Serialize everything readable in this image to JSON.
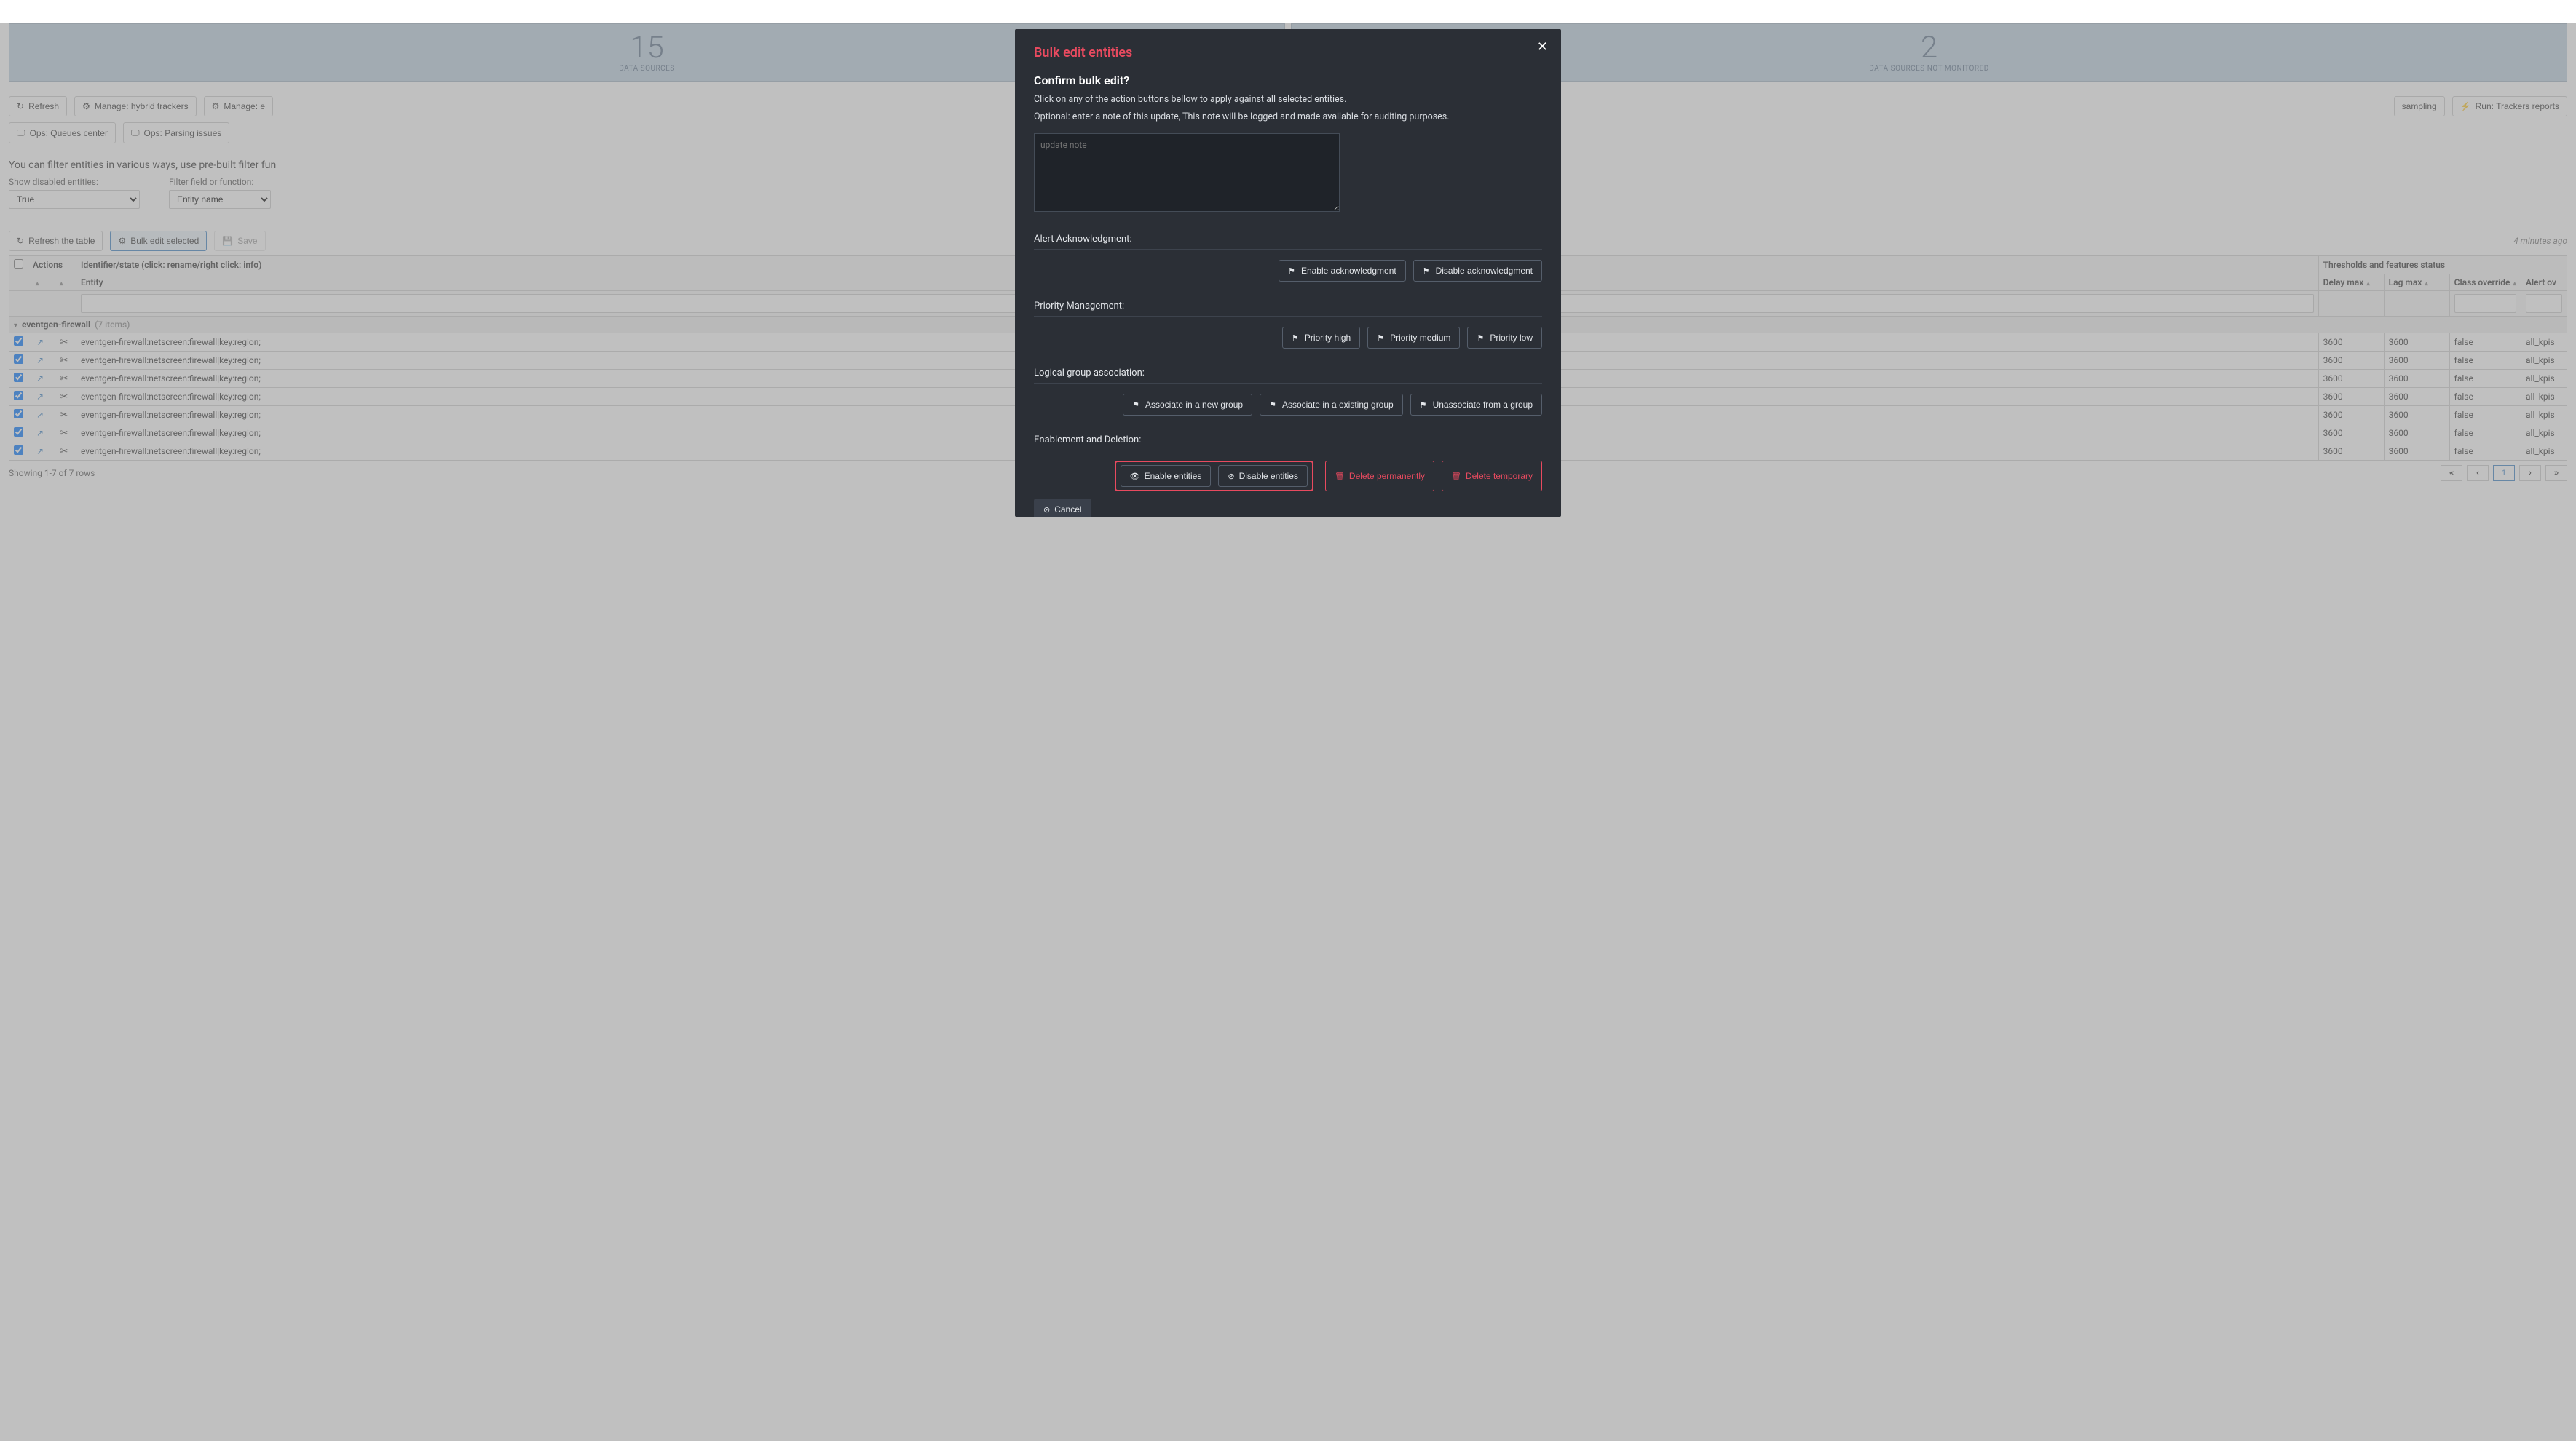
{
  "stats": [
    {
      "value": "15",
      "label": "DATA SOURCES"
    },
    {
      "value": "2",
      "label": "DATA SOURCES NOT MONITORED"
    }
  ],
  "toolbar": {
    "refresh": "Refresh",
    "manage_hybrid": "Manage: hybrid trackers",
    "manage_elastic": "Manage: e",
    "run_sampling": "sampling",
    "run_trackers": "Run: Trackers reports",
    "ops_queues": "Ops: Queues center",
    "ops_parsing": "Ops: Parsing issues"
  },
  "filter_hint": "You can filter entities in various ways, use pre-built filter fun",
  "filter": {
    "show_disabled_label": "Show disabled entities:",
    "show_disabled_value": "True",
    "field_label": "Filter field or function:",
    "field_value": "Entity name"
  },
  "actions": {
    "refresh_table": "Refresh the table",
    "bulk_edit": "Bulk edit selected",
    "save": "Save",
    "timestamp": "4 minutes ago"
  },
  "table": {
    "headers": {
      "actions": "Actions",
      "identifier": "Identifier/state (click: rename/right click: info)",
      "thresholds": "Thresholds and features status"
    },
    "sub_headers": {
      "entity": "Entity",
      "delay_max": "Delay max",
      "lag_max": "Lag max",
      "class_override": "Class override",
      "alert_override": "Alert ov"
    },
    "group": {
      "name": "eventgen-firewall",
      "count": "(7 items)"
    },
    "rows": [
      {
        "entity": "eventgen-firewall:netscreen:firewall|key:region;",
        "delay_max": "3600",
        "lag_max": "3600",
        "class_override": "false",
        "alert_override": "all_kpis"
      },
      {
        "entity": "eventgen-firewall:netscreen:firewall|key:region;",
        "delay_max": "3600",
        "lag_max": "3600",
        "class_override": "false",
        "alert_override": "all_kpis"
      },
      {
        "entity": "eventgen-firewall:netscreen:firewall|key:region;",
        "delay_max": "3600",
        "lag_max": "3600",
        "class_override": "false",
        "alert_override": "all_kpis"
      },
      {
        "entity": "eventgen-firewall:netscreen:firewall|key:region;",
        "delay_max": "3600",
        "lag_max": "3600",
        "class_override": "false",
        "alert_override": "all_kpis"
      },
      {
        "entity": "eventgen-firewall:netscreen:firewall|key:region;",
        "delay_max": "3600",
        "lag_max": "3600",
        "class_override": "false",
        "alert_override": "all_kpis"
      },
      {
        "entity": "eventgen-firewall:netscreen:firewall|key:region;",
        "delay_max": "3600",
        "lag_max": "3600",
        "class_override": "false",
        "alert_override": "all_kpis"
      },
      {
        "entity": "eventgen-firewall:netscreen:firewall|key:region;",
        "delay_max": "3600",
        "lag_max": "3600",
        "class_override": "false",
        "alert_override": "all_kpis"
      }
    ],
    "footer": "Showing 1-7 of 7 rows",
    "page": "1"
  },
  "modal": {
    "title": "Bulk edit entities",
    "confirm_heading": "Confirm bulk edit?",
    "instruction": "Click on any of the action buttons bellow to apply against all selected entities.",
    "optional_note": "Optional: enter a note of this update, This note will be logged and made available for auditing purposes.",
    "note_placeholder": "update note",
    "sections": {
      "ack": "Alert Acknowledgment:",
      "priority": "Priority Management:",
      "logical": "Logical group association:",
      "enable": "Enablement and Deletion:"
    },
    "buttons": {
      "enable_ack": "Enable acknowledgment",
      "disable_ack": "Disable acknowledgment",
      "prio_high": "Priority high",
      "prio_med": "Priority medium",
      "prio_low": "Priority low",
      "assoc_new": "Associate in a new group",
      "assoc_existing": "Associate in a existing group",
      "unassoc": "Unassociate from a group",
      "enable_ent": "Enable entities",
      "disable_ent": "Disable entities",
      "del_perm": "Delete permanently",
      "del_temp": "Delete temporary",
      "cancel": "Cancel"
    }
  }
}
